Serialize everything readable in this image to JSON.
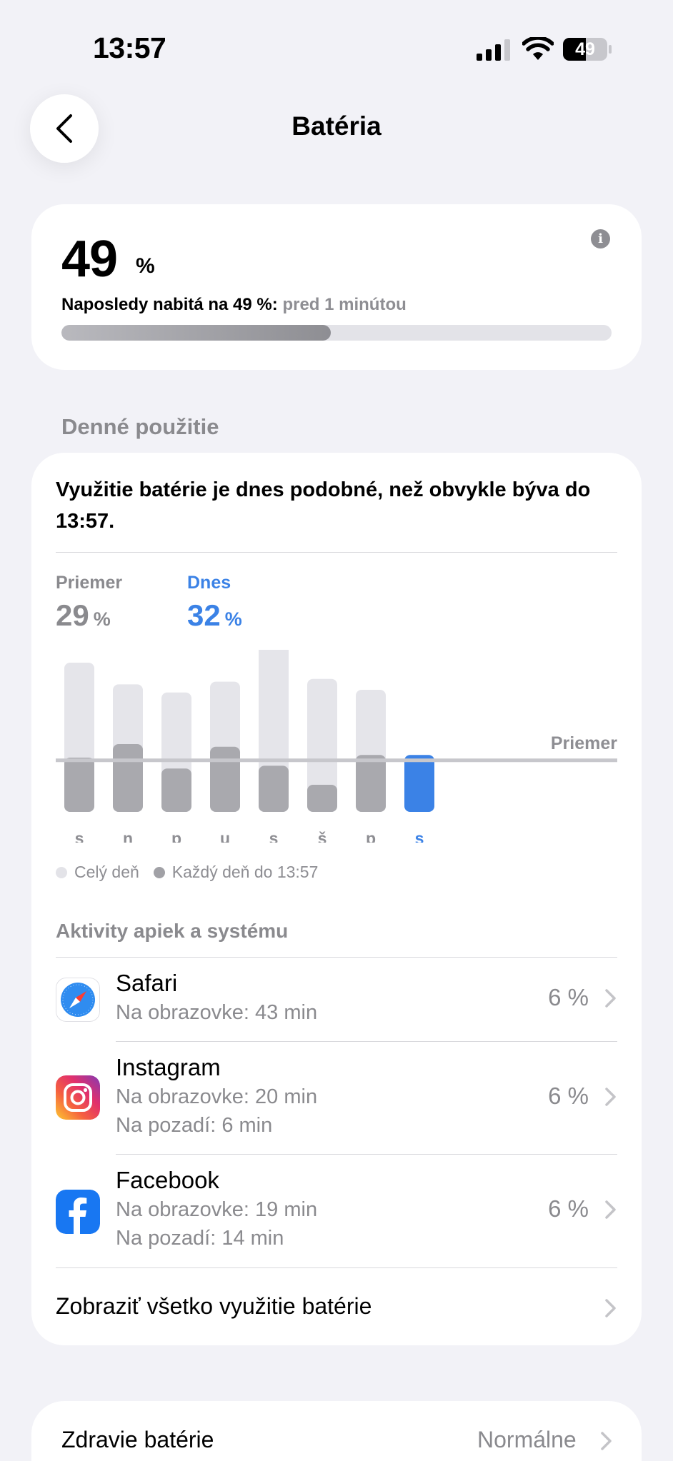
{
  "status_bar": {
    "time": "13:57",
    "battery_level": "49"
  },
  "nav": {
    "title": "Batéria"
  },
  "battery": {
    "percent": "49",
    "unit": "%",
    "last_charged_label": "Naposledy nabitá na 49 %:",
    "last_charged_time": "pred 1 minútou",
    "level_fraction": 0.49
  },
  "daily_usage": {
    "section_title": "Denné použitie",
    "summary": "Využitie batérie je dnes podobné, než obvykle býva do 13:57.",
    "average_label": "Priemer",
    "average_value": "29",
    "today_label": "Dnes",
    "today_value": "32",
    "unit": "%",
    "legend_full_day": "Celý deň",
    "legend_until_now": "Každý deň do 13:57"
  },
  "chart_data": {
    "type": "bar",
    "categories": [
      "s",
      "n",
      "p",
      "u",
      "s",
      "š",
      "p",
      "s"
    ],
    "series": [
      {
        "name": "Celý deň",
        "values": [
          55,
          47,
          44,
          48,
          62,
          49,
          45,
          null
        ]
      },
      {
        "name": "Každý deň do 13:57",
        "values": [
          20,
          25,
          16,
          24,
          17,
          10,
          21,
          21
        ]
      }
    ],
    "reference_line": {
      "label": "Priemer",
      "value": 19
    },
    "highlight_index": 7
  },
  "activities": {
    "section_title": "Aktivity apiek a systému",
    "apps": [
      {
        "name": "Safari",
        "icon": "safari-icon",
        "lines": [
          "Na obrazovke: 43 min"
        ],
        "percent": "6 %"
      },
      {
        "name": "Instagram",
        "icon": "instagram-icon",
        "lines": [
          "Na obrazovke: 20 min",
          "Na pozadí: 6 min"
        ],
        "percent": "6 %"
      },
      {
        "name": "Facebook",
        "icon": "facebook-icon",
        "lines": [
          "Na obrazovke: 19 min",
          "Na pozadí: 14 min"
        ],
        "percent": "6 %"
      }
    ],
    "show_all": "Zobraziť všetko využitie batérie"
  },
  "health": {
    "label": "Zdravie batérie",
    "value": "Normálne"
  },
  "colors": {
    "accent": "#3b82e6",
    "muted": "#8e8e93",
    "background": "#f2f2f7"
  }
}
